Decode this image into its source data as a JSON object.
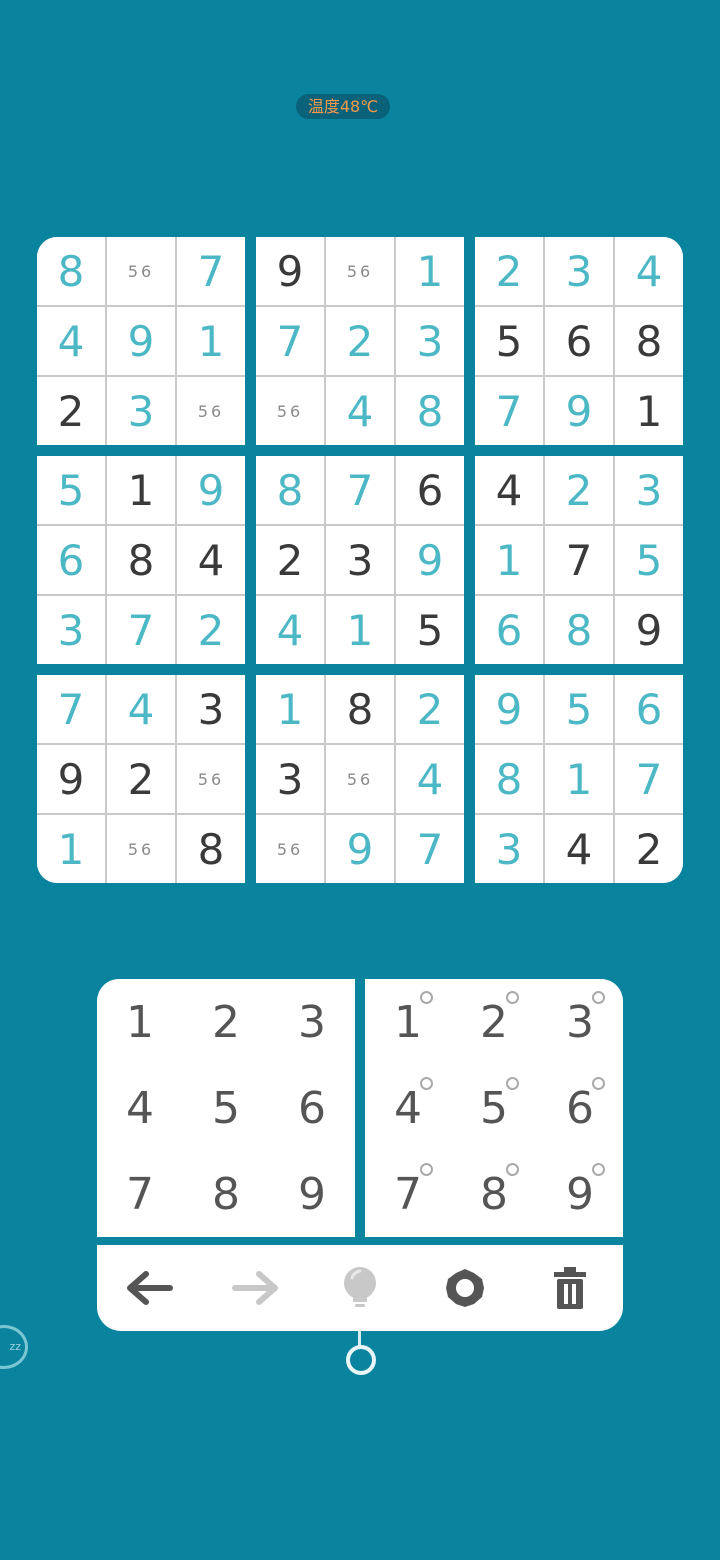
{
  "status": {
    "temperature": "温度48℃"
  },
  "board": {
    "boxes": [
      [
        {
          "v": "8",
          "t": "user"
        },
        {
          "v": "56",
          "t": "note"
        },
        {
          "v": "7",
          "t": "user"
        },
        {
          "v": "4",
          "t": "user"
        },
        {
          "v": "9",
          "t": "user"
        },
        {
          "v": "1",
          "t": "user"
        },
        {
          "v": "2",
          "t": "given"
        },
        {
          "v": "3",
          "t": "user"
        },
        {
          "v": "56",
          "t": "note"
        }
      ],
      [
        {
          "v": "9",
          "t": "given"
        },
        {
          "v": "56",
          "t": "note"
        },
        {
          "v": "1",
          "t": "user"
        },
        {
          "v": "7",
          "t": "user"
        },
        {
          "v": "2",
          "t": "user"
        },
        {
          "v": "3",
          "t": "user"
        },
        {
          "v": "56",
          "t": "note"
        },
        {
          "v": "4",
          "t": "user"
        },
        {
          "v": "8",
          "t": "user"
        }
      ],
      [
        {
          "v": "2",
          "t": "user"
        },
        {
          "v": "3",
          "t": "user"
        },
        {
          "v": "4",
          "t": "user"
        },
        {
          "v": "5",
          "t": "given"
        },
        {
          "v": "6",
          "t": "given"
        },
        {
          "v": "8",
          "t": "given"
        },
        {
          "v": "7",
          "t": "user"
        },
        {
          "v": "9",
          "t": "user"
        },
        {
          "v": "1",
          "t": "given"
        }
      ],
      [
        {
          "v": "5",
          "t": "user"
        },
        {
          "v": "1",
          "t": "given"
        },
        {
          "v": "9",
          "t": "user"
        },
        {
          "v": "6",
          "t": "user"
        },
        {
          "v": "8",
          "t": "given"
        },
        {
          "v": "4",
          "t": "given"
        },
        {
          "v": "3",
          "t": "user"
        },
        {
          "v": "7",
          "t": "user"
        },
        {
          "v": "2",
          "t": "user"
        }
      ],
      [
        {
          "v": "8",
          "t": "user"
        },
        {
          "v": "7",
          "t": "user"
        },
        {
          "v": "6",
          "t": "given"
        },
        {
          "v": "2",
          "t": "given"
        },
        {
          "v": "3",
          "t": "given"
        },
        {
          "v": "9",
          "t": "user"
        },
        {
          "v": "4",
          "t": "user"
        },
        {
          "v": "1",
          "t": "user"
        },
        {
          "v": "5",
          "t": "given"
        }
      ],
      [
        {
          "v": "4",
          "t": "given"
        },
        {
          "v": "2",
          "t": "user"
        },
        {
          "v": "3",
          "t": "user"
        },
        {
          "v": "1",
          "t": "user"
        },
        {
          "v": "7",
          "t": "given"
        },
        {
          "v": "5",
          "t": "user"
        },
        {
          "v": "6",
          "t": "user"
        },
        {
          "v": "8",
          "t": "user"
        },
        {
          "v": "9",
          "t": "given"
        }
      ],
      [
        {
          "v": "7",
          "t": "user"
        },
        {
          "v": "4",
          "t": "user"
        },
        {
          "v": "3",
          "t": "given"
        },
        {
          "v": "9",
          "t": "given"
        },
        {
          "v": "2",
          "t": "given"
        },
        {
          "v": "56",
          "t": "note"
        },
        {
          "v": "1",
          "t": "user"
        },
        {
          "v": "56",
          "t": "note"
        },
        {
          "v": "8",
          "t": "given"
        }
      ],
      [
        {
          "v": "1",
          "t": "user"
        },
        {
          "v": "8",
          "t": "given"
        },
        {
          "v": "2",
          "t": "user"
        },
        {
          "v": "3",
          "t": "given"
        },
        {
          "v": "56",
          "t": "note"
        },
        {
          "v": "4",
          "t": "user"
        },
        {
          "v": "56",
          "t": "note"
        },
        {
          "v": "9",
          "t": "user"
        },
        {
          "v": "7",
          "t": "user"
        }
      ],
      [
        {
          "v": "9",
          "t": "user"
        },
        {
          "v": "5",
          "t": "user"
        },
        {
          "v": "6",
          "t": "user"
        },
        {
          "v": "8",
          "t": "user"
        },
        {
          "v": "1",
          "t": "user"
        },
        {
          "v": "7",
          "t": "user"
        },
        {
          "v": "3",
          "t": "user"
        },
        {
          "v": "4",
          "t": "given"
        },
        {
          "v": "2",
          "t": "given"
        }
      ]
    ]
  },
  "number_pad": [
    "1",
    "2",
    "3",
    "4",
    "5",
    "6",
    "7",
    "8",
    "9"
  ],
  "note_pad": [
    "1",
    "2",
    "3",
    "4",
    "5",
    "6",
    "7",
    "8",
    "9"
  ],
  "toolbar": {
    "icons": [
      "undo-icon",
      "redo-icon",
      "hint-icon",
      "settings-icon",
      "delete-icon"
    ]
  },
  "colors": {
    "background": "#0a839f",
    "user_digit": "#4cb8c6",
    "given_digit": "#3a3a3a"
  }
}
